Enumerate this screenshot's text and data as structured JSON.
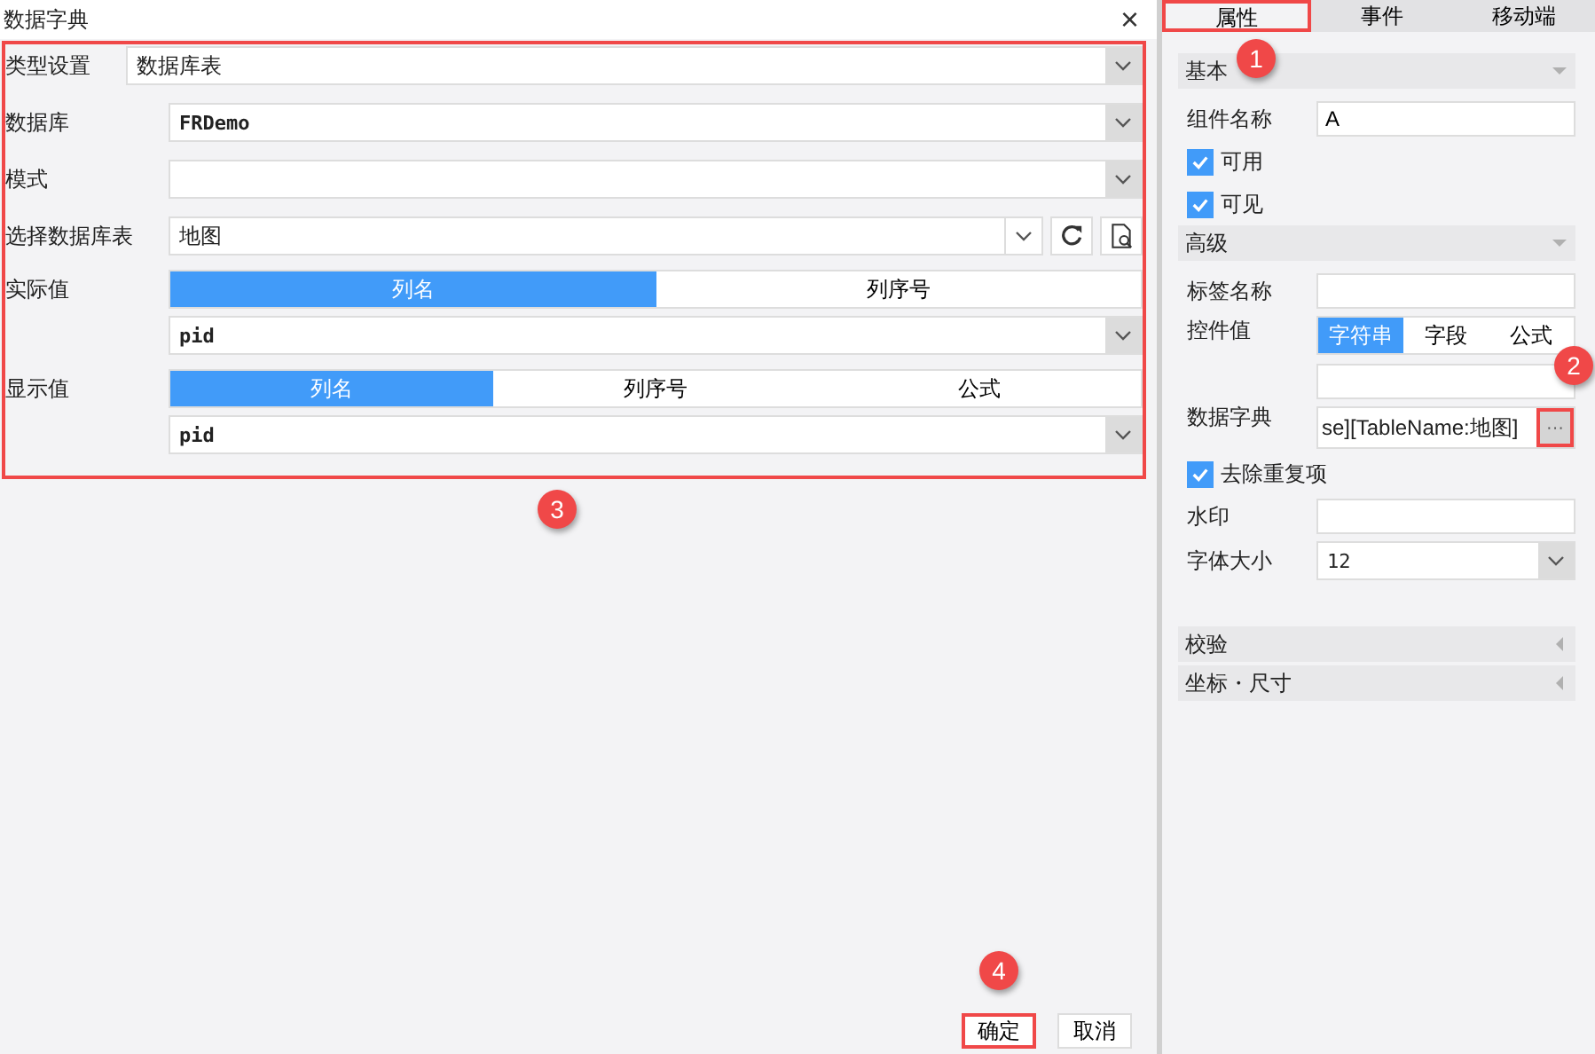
{
  "dialog": {
    "title": "数据字典",
    "close": "×",
    "rows": [
      {
        "kind": "select",
        "label": "类型设置",
        "value": "数据库表"
      },
      {
        "kind": "select",
        "label": "数据库",
        "value": "FRDemo"
      },
      {
        "kind": "select",
        "label": "模式",
        "value": ""
      },
      {
        "kind": "table",
        "label": "选择数据库表",
        "value": "地图"
      },
      {
        "kind": "column",
        "label": "实际值",
        "segments": [
          {
            "label": "列名",
            "selected": true
          },
          {
            "label": "列序号",
            "selected": false
          }
        ],
        "value": "pid"
      },
      {
        "kind": "column",
        "label": "显示值",
        "segments": [
          {
            "label": "列名",
            "selected": true
          },
          {
            "label": "列序号",
            "selected": false
          },
          {
            "label": "公式",
            "selected": false
          }
        ],
        "value": "pid"
      }
    ],
    "buttons": [
      {
        "label": "确定",
        "highlighted": true
      },
      {
        "label": "取消",
        "highlighted": false
      }
    ]
  },
  "panel": {
    "tabs": [
      {
        "label": "属性",
        "selected": true,
        "highlighted": true
      },
      {
        "label": "事件",
        "selected": false,
        "highlighted": false
      },
      {
        "label": "移动端",
        "selected": false,
        "highlighted": false
      }
    ],
    "sections": [
      {
        "title": "基本",
        "expanded": true,
        "items": [
          {
            "kind": "text",
            "label": "组件名称",
            "value": "A"
          },
          {
            "kind": "check",
            "label": "可用",
            "checked": true
          },
          {
            "kind": "check",
            "label": "可见",
            "checked": true
          }
        ]
      },
      {
        "title": "高级",
        "expanded": true,
        "items": [
          {
            "kind": "text",
            "label": "标签名称",
            "value": ""
          },
          {
            "kind": "segmented",
            "label": "控件值",
            "segments": [
              {
                "label": "字符串",
                "selected": true
              },
              {
                "label": "字段",
                "selected": false
              },
              {
                "label": "公式",
                "selected": false
              }
            ],
            "value": ""
          },
          {
            "kind": "dict",
            "label": "数据字典",
            "value": "se][TableName:地图]",
            "button": "···"
          },
          {
            "kind": "check",
            "label": "去除重复项",
            "checked": true
          },
          {
            "kind": "text",
            "label": "水印",
            "value": ""
          },
          {
            "kind": "select",
            "label": "字体大小",
            "value": "12"
          }
        ]
      },
      {
        "title": "校验",
        "expanded": false
      },
      {
        "title": "坐标・尺寸",
        "expanded": false
      }
    ]
  },
  "callouts": [
    "1",
    "2",
    "3",
    "4"
  ]
}
